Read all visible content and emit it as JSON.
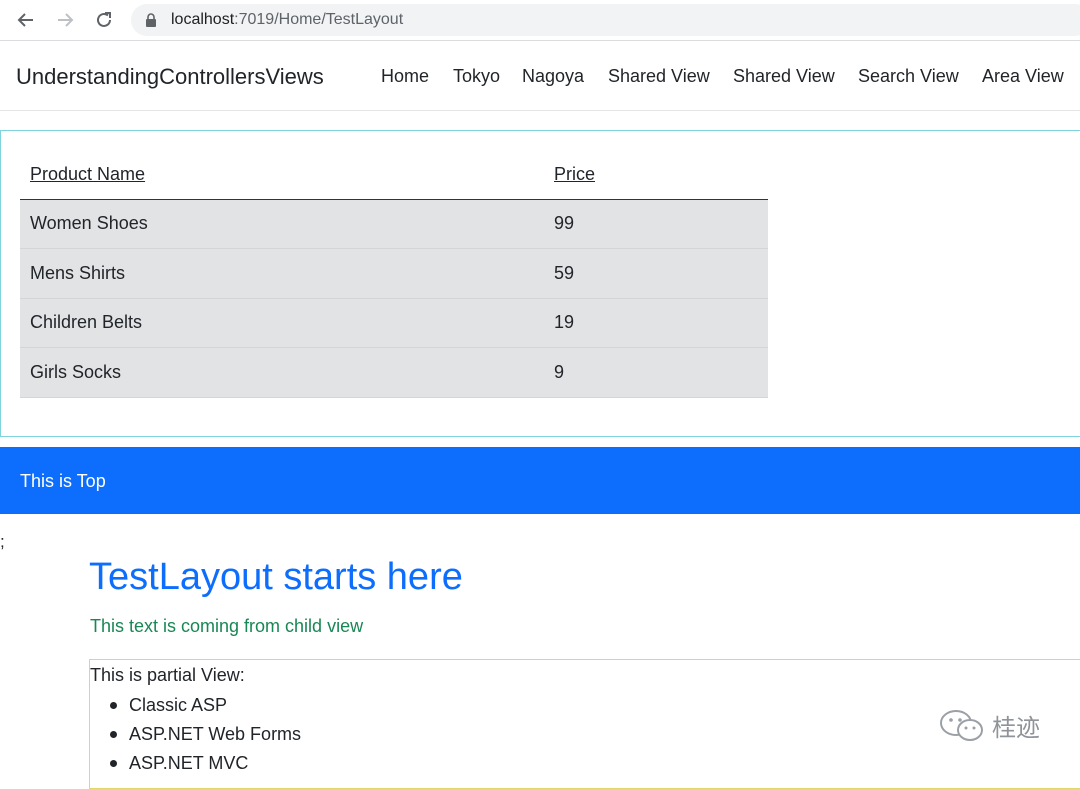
{
  "browser": {
    "url_host": "localhost",
    "url_path": ":7019/Home/TestLayout"
  },
  "navbar": {
    "brand": "UnderstandingControllersViews",
    "links": [
      "Home",
      "Tokyo",
      "Nagoya",
      "Shared View",
      "Shared View",
      "Search View",
      "Area View"
    ]
  },
  "products": {
    "headers": [
      "Product Name",
      "Price"
    ],
    "rows": [
      {
        "name": "Women Shoes",
        "price": "99"
      },
      {
        "name": "Mens Shirts",
        "price": "59"
      },
      {
        "name": "Children Belts",
        "price": "19"
      },
      {
        "name": "Girls Socks",
        "price": "9"
      }
    ]
  },
  "banner": {
    "text": "This is Top"
  },
  "stray": ";",
  "page": {
    "heading": "TestLayout starts here",
    "child_text": "This text is coming from child view"
  },
  "partial": {
    "title": "This is partial View:",
    "items": [
      "Classic ASP",
      "ASP.NET Web Forms",
      "ASP.NET MVC"
    ]
  },
  "watermark": {
    "text": "桂迹"
  },
  "colors": {
    "primary": "#0d6efd",
    "success": "#198754",
    "table_row_bg": "#e2e3e5"
  }
}
